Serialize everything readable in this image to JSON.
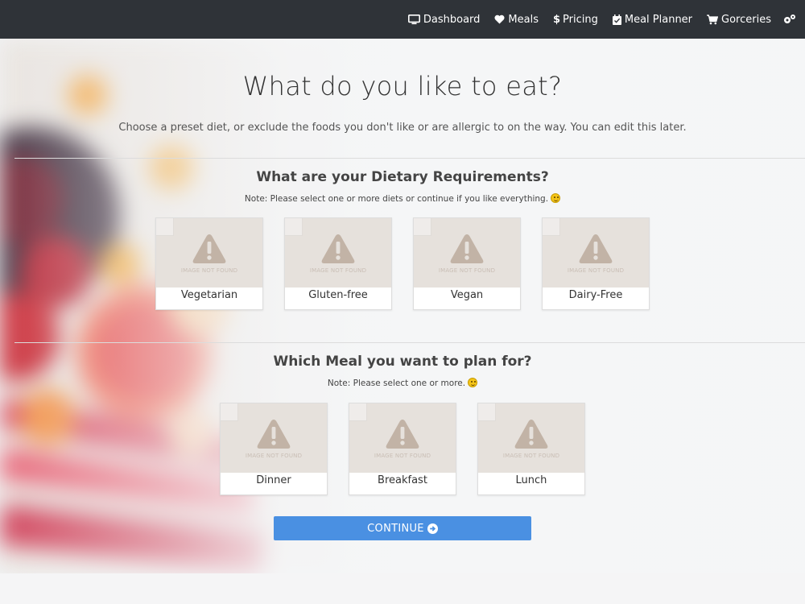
{
  "nav": {
    "items": [
      {
        "label": "Dashboard",
        "icon": "monitor-icon"
      },
      {
        "label": "Meals",
        "icon": "heart-icon"
      },
      {
        "label": "Pricing",
        "icon": "dollar-icon"
      },
      {
        "label": "Meal Planner",
        "icon": "calendar-check-icon"
      },
      {
        "label": "Gorceries",
        "icon": "cart-icon"
      }
    ],
    "settings_icon": "gears-icon"
  },
  "main": {
    "title": "What do you like to eat?",
    "subtitle": "Choose a preset diet, or exclude the foods you don't like or are allergic to on the way. You can edit this later."
  },
  "diets": {
    "title": "What are your Dietary Requirements?",
    "note": "Note: Please select one or more diets or continue if you like everything.",
    "items": [
      {
        "label": "Vegetarian",
        "image_text": "IMAGE NOT FOUND"
      },
      {
        "label": "Gluten-free",
        "image_text": "IMAGE NOT FOUND"
      },
      {
        "label": "Vegan",
        "image_text": "IMAGE NOT FOUND"
      },
      {
        "label": "Dairy-Free",
        "image_text": "IMAGE NOT FOUND"
      }
    ]
  },
  "meals": {
    "title": "Which Meal you want to plan for?",
    "note": "Note: Please select one or more.",
    "items": [
      {
        "label": "Dinner",
        "image_text": "IMAGE NOT FOUND"
      },
      {
        "label": "Breakfast",
        "image_text": "IMAGE NOT FOUND"
      },
      {
        "label": "Lunch",
        "image_text": "IMAGE NOT FOUND"
      }
    ]
  },
  "continue_label": "CONTINUE",
  "colors": {
    "navbar": "#2f3338",
    "accent": "#4a90e2",
    "placeholder": "#e6e1dc",
    "warning_glyph": "#c2b3a6"
  }
}
